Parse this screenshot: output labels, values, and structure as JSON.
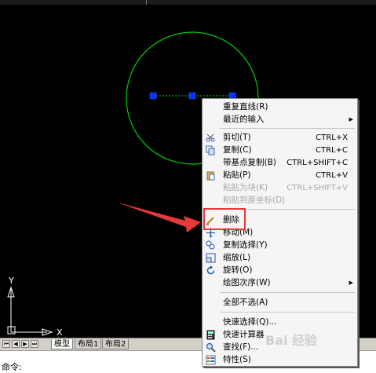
{
  "canvas": {
    "background": "#000000",
    "circle_color": "#00cc00",
    "grip_color": "#0033ff"
  },
  "ucs": {
    "y_label": "Y",
    "x_label": "X"
  },
  "tabs": {
    "nav": [
      "⏮",
      "◀",
      "▶",
      "⏭"
    ],
    "items": [
      {
        "label": "模型",
        "active": true
      },
      {
        "label": "布局1",
        "active": false
      },
      {
        "label": "布局2",
        "active": false
      }
    ]
  },
  "command": {
    "prompt": "命令:"
  },
  "menu": {
    "items": [
      {
        "label": "重复直线(R)",
        "shortcut": "",
        "icon": "",
        "disabled": false,
        "submenu": false
      },
      {
        "label": "最近的输入",
        "shortcut": "",
        "icon": "",
        "disabled": false,
        "submenu": true
      },
      {
        "label": "剪切(T)",
        "shortcut": "CTRL+X",
        "icon": "scissors-icon",
        "disabled": false,
        "submenu": false
      },
      {
        "label": "复制(C)",
        "shortcut": "CTRL+C",
        "icon": "copy-icon",
        "disabled": false,
        "submenu": false
      },
      {
        "label": "带基点复制(B)",
        "shortcut": "CTRL+SHIFT+C",
        "icon": "",
        "disabled": false,
        "submenu": false
      },
      {
        "label": "粘贴(P)",
        "shortcut": "CTRL+V",
        "icon": "paste-icon",
        "disabled": false,
        "submenu": false
      },
      {
        "label": "粘贴为块(K)",
        "shortcut": "CTRL+SHIFT+V",
        "icon": "",
        "disabled": true,
        "submenu": false
      },
      {
        "label": "粘贴到原坐标(D)",
        "shortcut": "",
        "icon": "",
        "disabled": true,
        "submenu": false
      },
      {
        "label": "删除",
        "shortcut": "",
        "icon": "eraser-icon",
        "disabled": false,
        "submenu": false
      },
      {
        "label": "移动(M)",
        "shortcut": "",
        "icon": "move-icon",
        "disabled": false,
        "submenu": false
      },
      {
        "label": "复制选择(Y)",
        "shortcut": "",
        "icon": "copy-select-icon",
        "disabled": false,
        "submenu": false
      },
      {
        "label": "缩放(L)",
        "shortcut": "",
        "icon": "scale-icon",
        "disabled": false,
        "submenu": false
      },
      {
        "label": "旋转(O)",
        "shortcut": "",
        "icon": "rotate-icon",
        "disabled": false,
        "submenu": false
      },
      {
        "label": "绘图次序(W)",
        "shortcut": "",
        "icon": "",
        "disabled": false,
        "submenu": true
      },
      {
        "label": "全部不选(A)",
        "shortcut": "",
        "icon": "",
        "disabled": false,
        "submenu": false
      },
      {
        "label": "快速选择(Q)...",
        "shortcut": "",
        "icon": "",
        "disabled": false,
        "submenu": false
      },
      {
        "label": "快速计算器",
        "shortcut": "",
        "icon": "calculator-icon",
        "disabled": false,
        "submenu": false
      },
      {
        "label": "查找(F)...",
        "shortcut": "",
        "icon": "find-icon",
        "disabled": false,
        "submenu": false
      },
      {
        "label": "特性(S)",
        "shortcut": "",
        "icon": "properties-icon",
        "disabled": false,
        "submenu": false
      }
    ]
  },
  "highlight_color": "#e63a3a",
  "watermark": {
    "text": "Bai 经验"
  }
}
